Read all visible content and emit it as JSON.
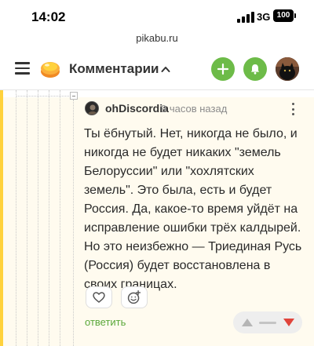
{
  "status_bar": {
    "time": "14:02",
    "network": "3G",
    "battery": "100"
  },
  "browser": {
    "url": "pikabu.ru"
  },
  "header": {
    "title": "Комментарии"
  },
  "comment": {
    "author": "ohDiscordia",
    "time": "9 часов назад",
    "text": "Ты ёбнутый. Нет, никогда не было, и никогда не будет никаких \"земель Белоруссии\" или \"хохлятских земель\". Это была, есть и будет Россия. Да, какое-то время уйдёт на исправление ошибки трёх калдырей. Но это неизбежно — Триединая Русь (Россия) будет восстановлена в своих границах.",
    "reply_label": "ответить"
  },
  "icons": {
    "menu": "hamburger-menu-icon",
    "logo": "pikabu-logo-icon",
    "caret": "chevron-up-icon",
    "add": "plus-icon",
    "bell": "bell-icon",
    "more": "vertical-dots-icon",
    "like": "heart-icon",
    "emoji": "add-emoji-icon",
    "up": "upvote-triangle-icon",
    "down": "downvote-triangle-icon"
  },
  "colors": {
    "accent_green": "#6dbb48",
    "reply_green": "#5aa83a",
    "tree_yellow": "#ffd23c",
    "downvote_red": "#e0443b",
    "upvote_gray": "#b5b5b5"
  }
}
